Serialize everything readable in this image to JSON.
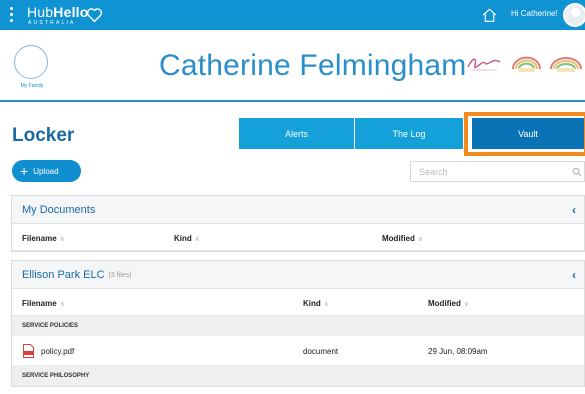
{
  "topbar": {
    "logo_main_a": "Hub",
    "logo_main_b": "Hello",
    "logo_sub": "AUSTRALIA",
    "greeting": "Hi Catherine!"
  },
  "header": {
    "family_label": "My Family",
    "child_name": "Catherine Felmingham"
  },
  "locker": {
    "title": "Locker",
    "tabs": [
      {
        "label": "Alerts"
      },
      {
        "label": "The Log"
      },
      {
        "label": "Vault",
        "active": true
      }
    ],
    "upload_label": "Upload",
    "search_placeholder": "Search"
  },
  "my_documents": {
    "title": "My Documents",
    "columns": {
      "filename": "Filename",
      "kind": "Kind",
      "modified": "Modified"
    }
  },
  "centre": {
    "title": "Ellison Park ELC",
    "count": "(3 files)",
    "columns": {
      "filename": "Filename",
      "kind": "Kind",
      "modified": "Modified"
    },
    "sections": [
      {
        "name": "SERVICE POLICIES",
        "files": [
          {
            "filename": "policy.pdf",
            "kind": "document",
            "modified": "29 Jun, 08:09am"
          }
        ]
      },
      {
        "name": "SERVICE PHILOSOPHY",
        "files": []
      }
    ]
  },
  "colors": {
    "topbar": "#0f93d2",
    "tab": "#14a0d8",
    "tab_active": "#0a73b6",
    "highlight_frame": "#f28a1e",
    "title_blue": "#1a6aa3"
  }
}
